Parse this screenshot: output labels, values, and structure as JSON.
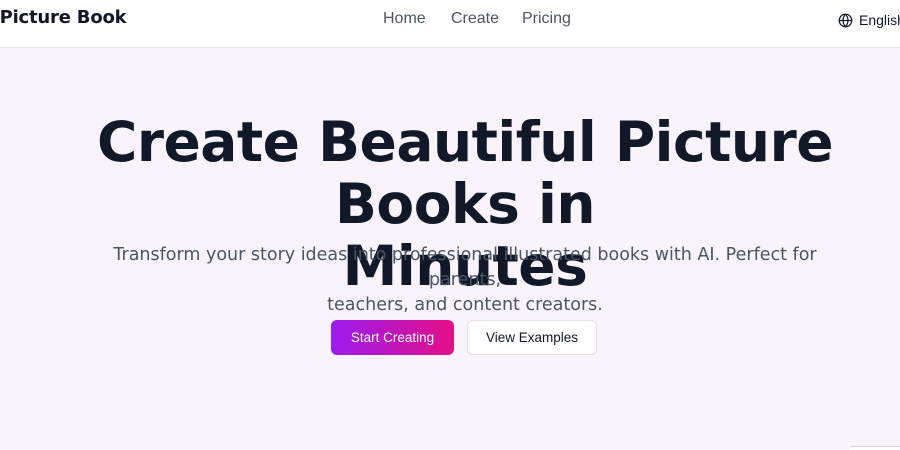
{
  "header": {
    "brand": "y Picture Book",
    "nav": {
      "home": "Home",
      "create": "Create",
      "pricing": "Pricing"
    },
    "language": {
      "icon": "globe-icon",
      "label": "English"
    }
  },
  "hero": {
    "title_line1": "Create Beautiful Picture Books in",
    "title_line2": "Minutes",
    "subtitle_line1": "Transform your story ideas into professional illustrated books with AI. Perfect for parents,",
    "subtitle_line2": "teachers, and content creators.",
    "primary_button": "Start Creating",
    "secondary_button": "View Examples"
  },
  "colors": {
    "accent_gradient_start": "#9b1bf0",
    "accent_gradient_end": "#e50f86",
    "hero_background": "#f9f4fb",
    "heading_text": "#111827",
    "body_text": "#4b5563"
  }
}
